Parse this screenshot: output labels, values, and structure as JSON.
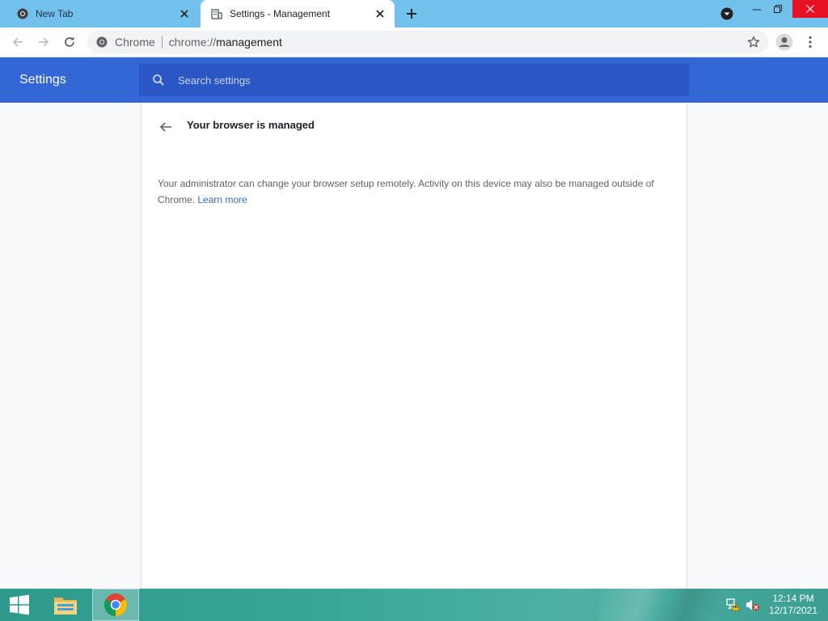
{
  "tabs": [
    {
      "title": "New Tab",
      "icon": "chrome-icon",
      "active": false
    },
    {
      "title": "Settings - Management",
      "icon": "building-icon",
      "active": true
    }
  ],
  "toolbar": {
    "site_chip": "Chrome",
    "url_scheme": "chrome://",
    "url_path": "management"
  },
  "settings": {
    "title": "Settings",
    "search_placeholder": "Search settings"
  },
  "management": {
    "heading": "Your browser is managed",
    "description": "Your administrator can change your browser setup remotely. Activity on this device may also be managed outside of Chrome.",
    "learn_more": "Learn more"
  },
  "taskbar": {
    "time": "12:14 PM",
    "date": "12/17/2021"
  },
  "colors": {
    "tabstrip": "#72c0ec",
    "settings_header": "#3367d6",
    "search_box": "#2a56c6",
    "link": "#3367d6",
    "close_button": "#e81123"
  }
}
